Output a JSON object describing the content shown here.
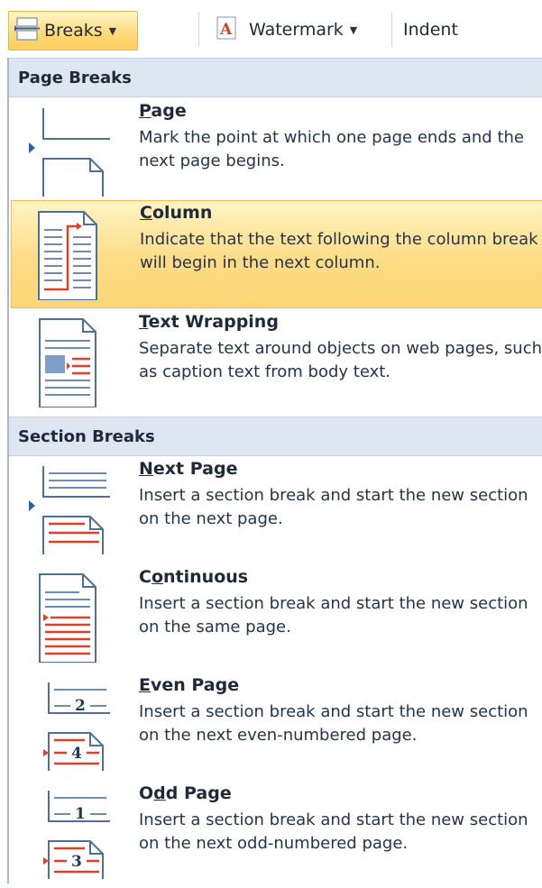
{
  "ribbon": {
    "breaks_label": "Breaks",
    "watermark_label": "Watermark",
    "indent_label": "Indent"
  },
  "menu": {
    "page_breaks_header": "Page Breaks",
    "section_breaks_header": "Section Breaks",
    "items": [
      {
        "key_char": "P",
        "rest": "age",
        "desc": "Mark the point at which one page ends and the next page begins.",
        "icon": "page-break-icon"
      },
      {
        "key_char": "C",
        "rest": "olumn",
        "desc": "Indicate that the text following the column break will begin in the next column.",
        "icon": "column-break-icon"
      },
      {
        "key_char": "T",
        "rest": "ext Wrapping",
        "desc": "Separate text around objects on web pages, such as caption text from body text.",
        "icon": "text-wrapping-break-icon"
      },
      {
        "key_char": "N",
        "rest": "ext Page",
        "desc": "Insert a section break and start the new section on the next page.",
        "icon": "next-page-section-icon"
      },
      {
        "pre": "C",
        "key_char": "o",
        "rest": "ntinuous",
        "desc": "Insert a section break and start the new section on the same page.",
        "icon": "continuous-section-icon"
      },
      {
        "key_char": "E",
        "rest": "ven Page",
        "desc": "Insert a section break and start the new section on the next even-numbered page.",
        "icon": "even-page-section-icon"
      },
      {
        "pre": "O",
        "key_char": "d",
        "rest": "d Page",
        "desc": "Insert a section break and start the new section on the next odd-numbered page.",
        "icon": "odd-page-section-icon"
      }
    ],
    "even_num_top": "2",
    "even_num_bottom": "4",
    "odd_num_top": "1",
    "odd_num_bottom": "3"
  },
  "colors": {
    "highlight": "#fddc86",
    "header_bg": "#dde6f1",
    "accent_red": "#d9412b",
    "accent_blue": "#2b5fb3"
  }
}
